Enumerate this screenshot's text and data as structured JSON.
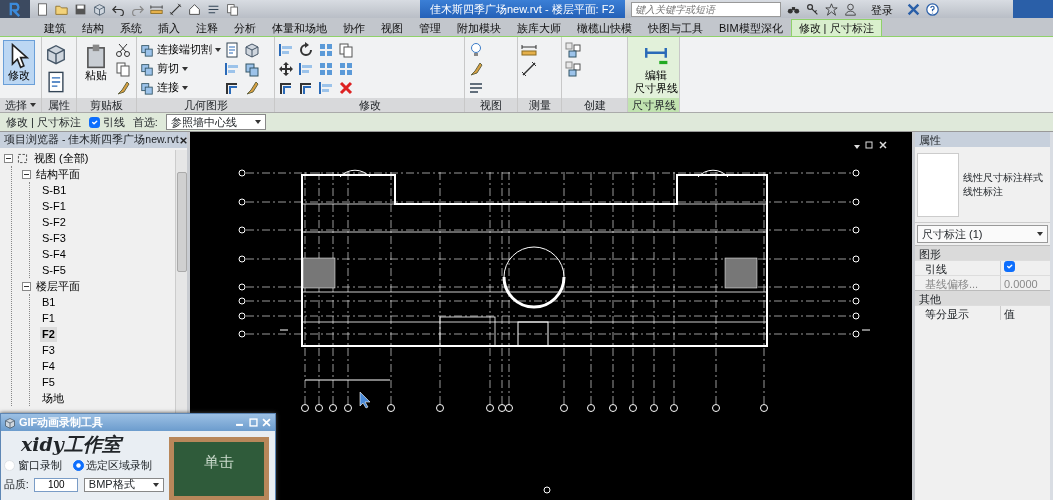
{
  "title_bar": {
    "title": "佳木斯四季广场new.rvt - 楼层平面: F2",
    "search": {
      "placeholder": "键入关键字或短语"
    },
    "login": "登录"
  },
  "tabs": [
    {
      "label": "建筑",
      "selected": false
    },
    {
      "label": "结构",
      "selected": false
    },
    {
      "label": "系统",
      "selected": false
    },
    {
      "label": "插入",
      "selected": false
    },
    {
      "label": "注释",
      "selected": false
    },
    {
      "label": "分析",
      "selected": false
    },
    {
      "label": "体量和场地",
      "selected": false
    },
    {
      "label": "协作",
      "selected": false
    },
    {
      "label": "视图",
      "selected": false
    },
    {
      "label": "管理",
      "selected": false
    },
    {
      "label": "附加模块",
      "selected": false
    },
    {
      "label": "族库大师",
      "selected": false
    },
    {
      "label": "橄榄山快模",
      "selected": false
    },
    {
      "label": "快图与工具",
      "selected": false
    },
    {
      "label": "BIM模型深化",
      "selected": false
    },
    {
      "label": "修改 | 尺寸标注",
      "selected": true
    }
  ],
  "ribbon": {
    "panels": [
      {
        "label": "选择",
        "menu": true,
        "contextual": false,
        "tools": [
          {
            "label": "修改",
            "selected": true
          }
        ]
      },
      {
        "label": "属性",
        "menu": false,
        "contextual": false
      },
      {
        "label": "剪贴板",
        "menu": false,
        "contextual": false,
        "tools": [
          {
            "label": "粘贴",
            "selected": false
          }
        ]
      },
      {
        "label": "几何图形",
        "menu": false,
        "contextual": false,
        "tools": [
          {
            "label": "连接端切割",
            "selected": false
          },
          {
            "label": "剪切",
            "selected": false
          },
          {
            "label": "连接",
            "selected": false
          }
        ]
      },
      {
        "label": "修改",
        "menu": false,
        "contextual": false
      },
      {
        "label": "视图",
        "menu": false,
        "contextual": false
      },
      {
        "label": "测量",
        "menu": false,
        "contextual": false
      },
      {
        "label": "创建",
        "menu": false,
        "contextual": false
      },
      {
        "label": "尺寸界线",
        "menu": false,
        "contextual": true,
        "tools": [
          {
            "label_lines": [
              "编辑",
              "尺寸界线"
            ],
            "selected": false
          }
        ]
      }
    ]
  },
  "options_bar": {
    "context": "修改 | 尺寸标注",
    "leader": {
      "label": "引线",
      "checked": true
    },
    "prefer_label": "首选:",
    "prefer_value": "参照墙中心线"
  },
  "project_browser": {
    "title": "项目浏览器 - 佳木斯四季广场new.rvt",
    "tree": [
      {
        "label": "视图 (全部)",
        "expanded": true,
        "selected": false,
        "children": [
          {
            "label": "结构平面",
            "expanded": true,
            "selected": false,
            "children": [
              {
                "label": "S-B1",
                "selected": false
              },
              {
                "label": "S-F1",
                "selected": false
              },
              {
                "label": "S-F2",
                "selected": false
              },
              {
                "label": "S-F3",
                "selected": false
              },
              {
                "label": "S-F4",
                "selected": false
              },
              {
                "label": "S-F5",
                "selected": false
              }
            ]
          },
          {
            "label": "楼层平面",
            "expanded": true,
            "selected": false,
            "children": [
              {
                "label": "B1",
                "selected": false
              },
              {
                "label": "F1",
                "selected": false
              },
              {
                "label": "F2",
                "selected": true
              },
              {
                "label": "F3",
                "selected": false
              },
              {
                "label": "F4",
                "selected": false
              },
              {
                "label": "F5",
                "selected": false
              },
              {
                "label": "场地",
                "selected": false
              }
            ]
          }
        ]
      }
    ]
  },
  "properties": {
    "title": "属性",
    "type_family": "线性尺寸标注样式",
    "type": "线性标注",
    "selector": "尺寸标注 (1)",
    "groups": [
      {
        "name": "图形",
        "rows": [
          {
            "label": "引线",
            "kind": "checkbox",
            "checked": true,
            "disabled": false
          },
          {
            "label": "基线偏移...",
            "kind": "text",
            "value": "0.0000",
            "disabled": true
          }
        ]
      },
      {
        "name": "其他",
        "rows": [
          {
            "label": "等分显示",
            "kind": "text",
            "value": "值",
            "disabled": false
          }
        ]
      }
    ]
  },
  "gif_tool": {
    "title": "GIF动画录制工具",
    "brand": "xidy工作室",
    "modes": [
      {
        "label": "窗口录制",
        "selected": false
      },
      {
        "label": "选定区域录制",
        "selected": true
      }
    ],
    "quality_label": "品质:",
    "quality": "100",
    "format": "BMP格式",
    "start": "单击"
  }
}
